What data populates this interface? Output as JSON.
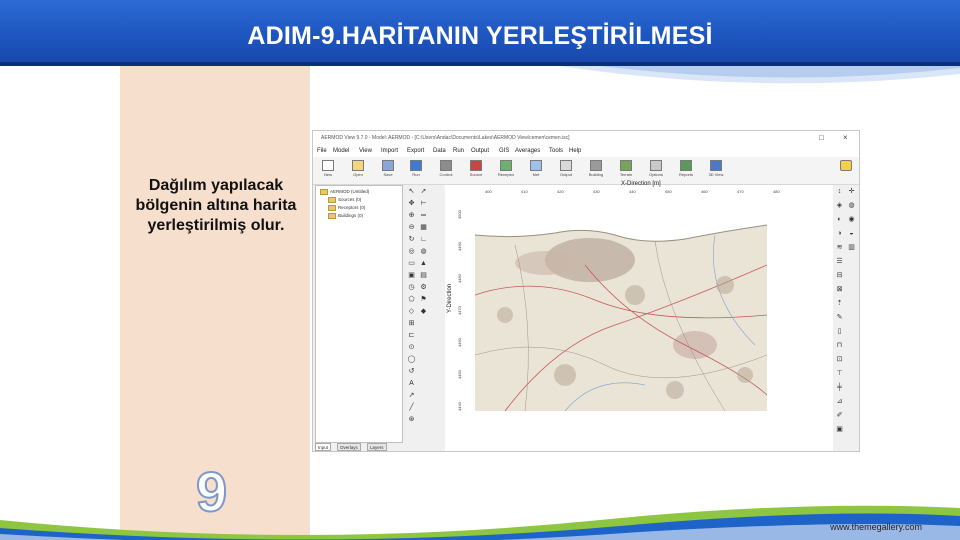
{
  "slide": {
    "title": "ADIM-9.HARİTANIN YERLEŞTİRİLMESİ",
    "side_text": "Dağılım yapılacak bölgenin altına harita yerleştirilmiş olur.",
    "slide_number": "9",
    "footer_url": "www.themegallery.com"
  },
  "app": {
    "window_title": "AERMOD View 9.7.0 - Model: AERMOD - [C:\\Users\\Andac\\Documents\\Lakes\\AERMOD View\\cemen\\cemen.isc]",
    "menu": [
      "File",
      "Model",
      "View",
      "Import",
      "Export",
      "Data",
      "Run",
      "Output",
      "GIS",
      "Averages",
      "Tools",
      "Help"
    ],
    "toolbar": [
      "New",
      "Open",
      "Save",
      "Print",
      "Run",
      "Control",
      "Source",
      "Receptor",
      "Met",
      "Output",
      "Building",
      "Terrain",
      "Options",
      "Reports",
      "3D View"
    ],
    "tree": {
      "root": "AERMOD (Untitled)",
      "items": [
        "Sources (0)",
        "Receptors (0)",
        "Buildings (0)"
      ]
    },
    "tree_tabs": [
      "Input",
      "Overlays",
      "Layers"
    ],
    "map": {
      "x_axis_title": "X-Direction [m]",
      "y_axis_title": "Y-Direction",
      "x_ticks": [
        "400",
        "410",
        "420",
        "430",
        "440",
        "450",
        "460",
        "470",
        "480"
      ],
      "y_ticks": [
        "4500",
        "4490",
        "4480",
        "4470",
        "4460",
        "4450",
        "4440"
      ]
    }
  }
}
